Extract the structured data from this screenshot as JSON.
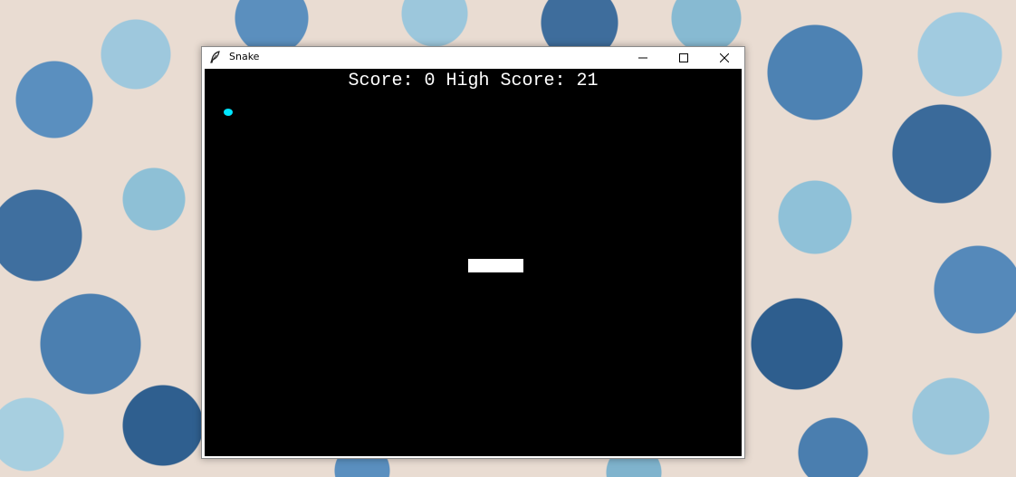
{
  "window": {
    "title": "Snake",
    "controls": {
      "minimize": "minimize-icon",
      "maximize": "maximize-icon",
      "close": "close-icon"
    }
  },
  "game": {
    "score_label": "Score:",
    "score_value": "0",
    "high_score_label": "High Score:",
    "high_score_value": "21",
    "food_color": "#00e5ff",
    "snake_color": "#ffffff",
    "background_color": "#000000"
  }
}
